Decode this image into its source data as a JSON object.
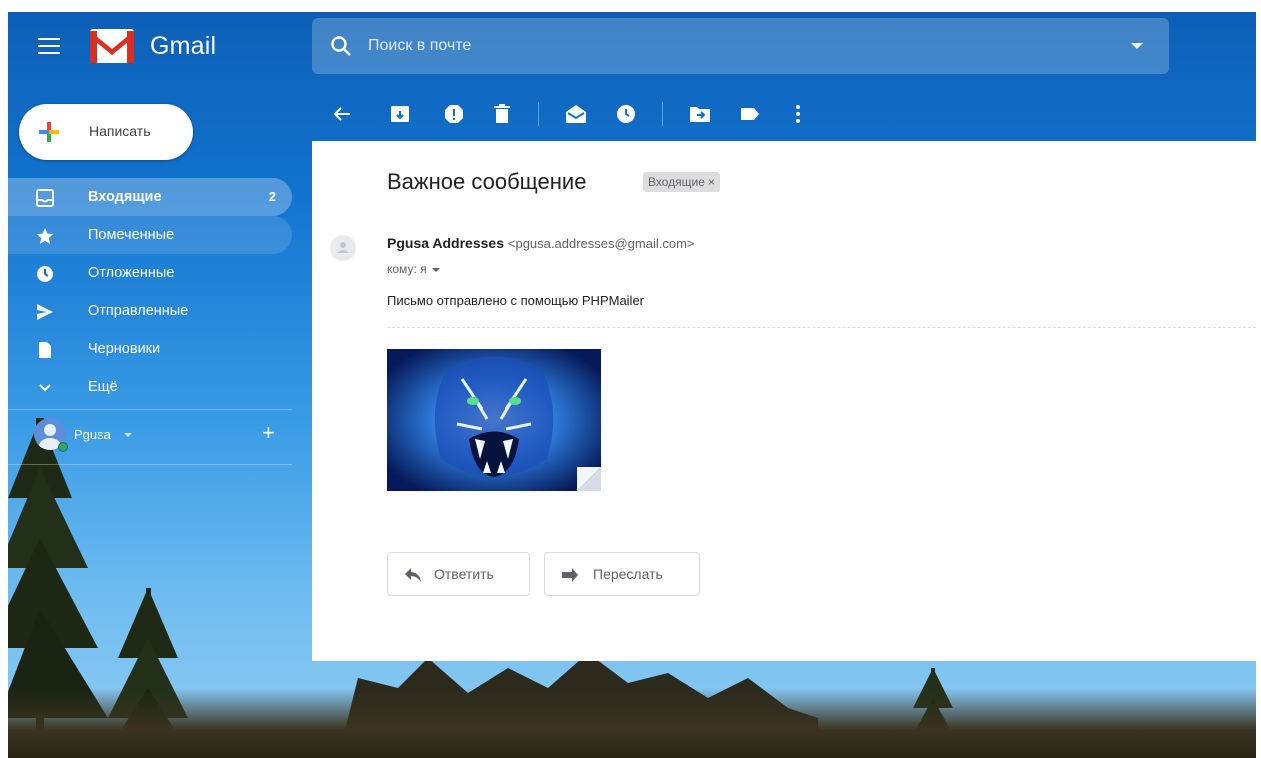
{
  "app": {
    "name": "Gmail"
  },
  "search": {
    "placeholder": "Поиск в почте"
  },
  "compose": {
    "label": "Написать"
  },
  "sidebar": {
    "items": [
      {
        "label": "Входящие",
        "count": "2",
        "icon": "inbox-icon"
      },
      {
        "label": "Помеченные",
        "count": "",
        "icon": "star-icon"
      },
      {
        "label": "Отложенные",
        "count": "",
        "icon": "clock-icon"
      },
      {
        "label": "Отправленные",
        "count": "",
        "icon": "send-icon"
      },
      {
        "label": "Черновики",
        "count": "",
        "icon": "draft-icon"
      },
      {
        "label": "Ещё",
        "count": "",
        "icon": "chevron-down-icon"
      }
    ]
  },
  "account": {
    "name": "Pgusa",
    "add_symbol": "+"
  },
  "toolbar": {
    "buttons": [
      "back-arrow-icon",
      "archive-icon",
      "report-spam-icon",
      "delete-icon",
      "mark-unread-icon",
      "snooze-icon",
      "move-to-icon",
      "label-icon",
      "more-vert-icon"
    ]
  },
  "message": {
    "subject": "Важное сообщение",
    "label": "Входящие",
    "label_close": "×",
    "sender_name": "Pgusa Addresses",
    "sender_email": "<pgusa.addresses@gmail.com>",
    "to": "кому: я",
    "body": "Письмо отправлено с помощью PHPMailer"
  },
  "actions": {
    "reply": "Ответить",
    "forward": "Переслать"
  },
  "colors": {
    "header_blue": "#1470cc",
    "accent_green": "#34a853",
    "chip_bg": "#dddddd"
  }
}
